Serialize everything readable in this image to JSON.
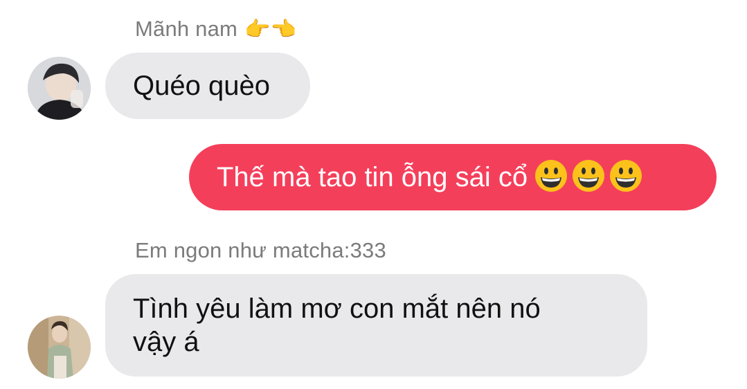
{
  "messages": [
    {
      "sender": "Mãnh nam",
      "sender_emoji": "👉👈",
      "text": "Quéo quèo",
      "direction": "incoming"
    },
    {
      "text": "Thế mà tao tin ỗng sái cổ",
      "emoji_count": 3,
      "emoji_icon": "grinning-face-icon",
      "direction": "outgoing"
    },
    {
      "sender": "Em ngon như matcha:333",
      "text_line1": "Tình yêu làm mơ con mắt nên nó",
      "text_line2": "vậy á",
      "direction": "incoming"
    }
  ],
  "colors": {
    "incoming_bubble": "#e9e9eb",
    "outgoing_bubble": "#f43f5b",
    "sender_name": "#7b7b7b"
  }
}
